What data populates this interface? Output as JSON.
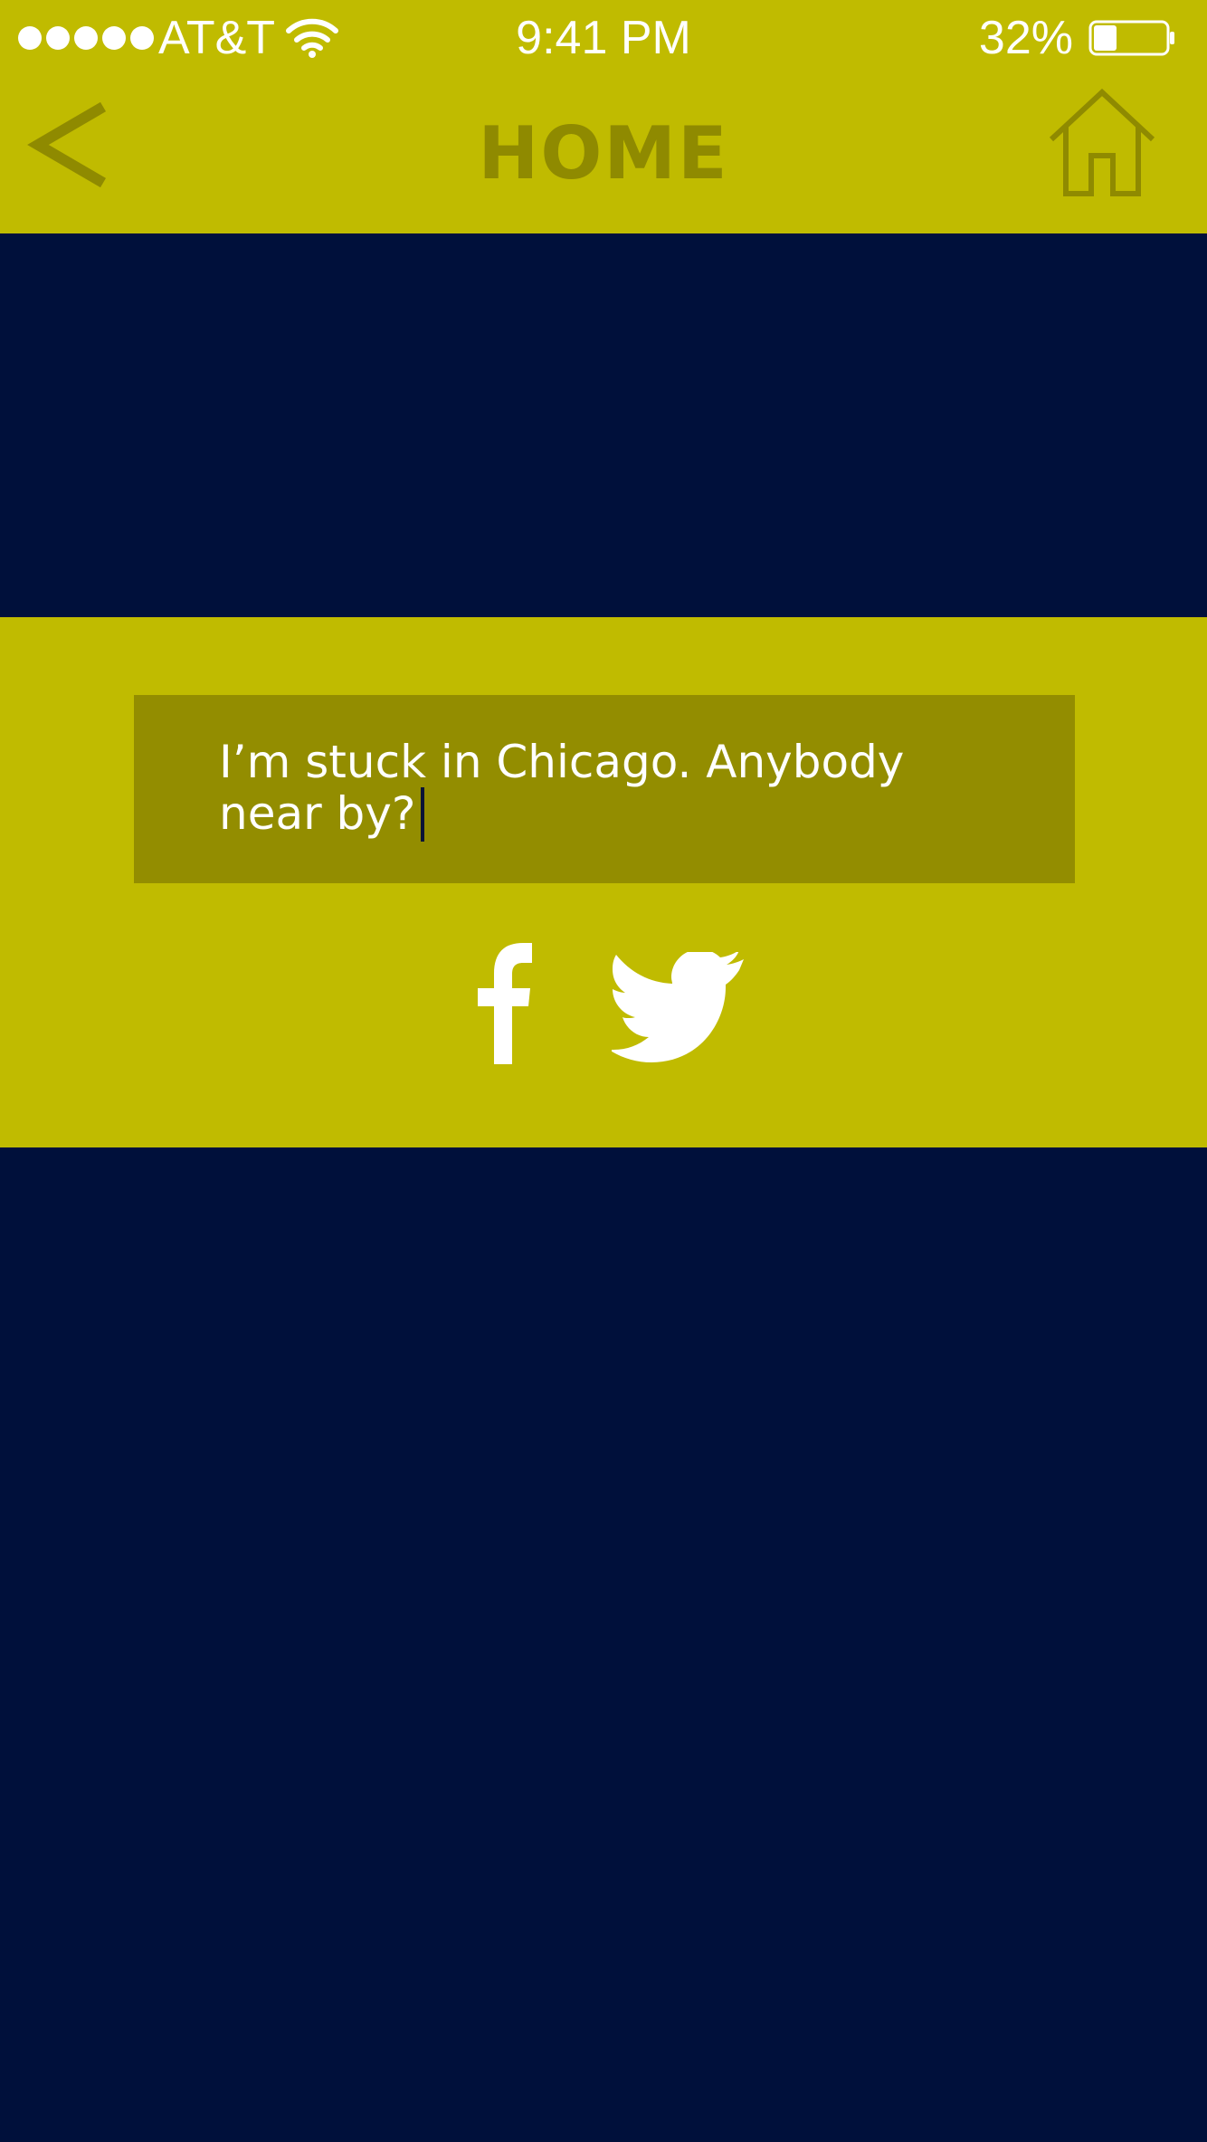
{
  "status_bar": {
    "carrier": "AT&T",
    "time": "9:41 PM",
    "battery_percent": "32%",
    "signal_bars": 5,
    "battery_level": 0.32
  },
  "nav": {
    "title": "HOME",
    "back_icon": "chevron-left-icon",
    "home_icon": "house-outline-icon"
  },
  "composer": {
    "text": "I’m stuck in Chicago. Anybody near by?"
  },
  "share": {
    "facebook_icon": "facebook-icon",
    "twitter_icon": "twitter-icon"
  },
  "colors": {
    "accent_yellow": "#c0bb00",
    "input_olive": "#938d00",
    "nav_icon_olive": "#8f8a00",
    "navy_background": "#00103b",
    "text_white": "#ffffff"
  }
}
